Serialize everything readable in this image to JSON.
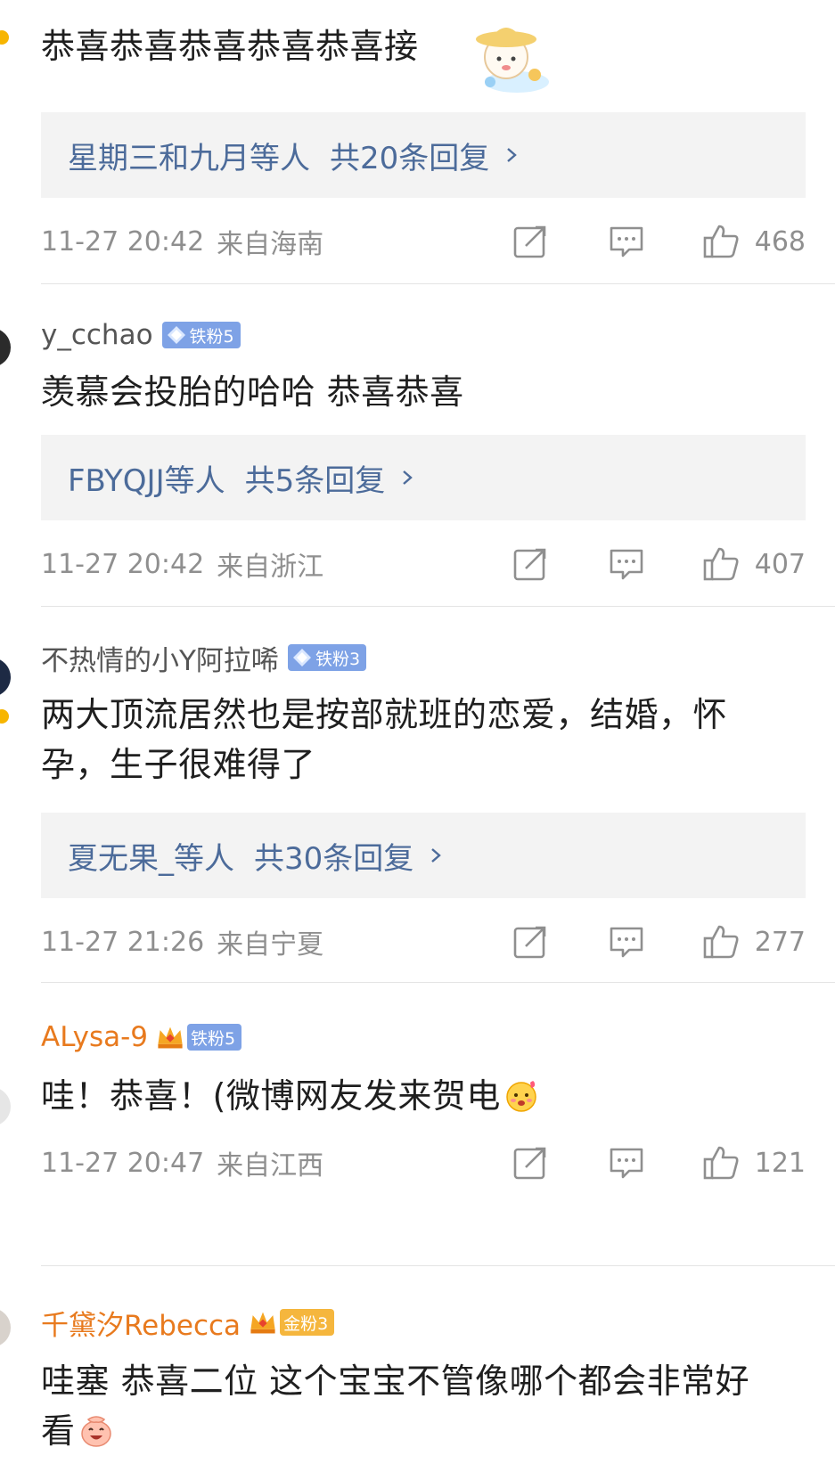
{
  "comments": [
    {
      "username": "",
      "text": "恭喜恭喜恭喜恭喜恭喜接",
      "replies": {
        "who": "星期三和九月等人",
        "count": "共20条回复"
      },
      "time": "11-27 20:42",
      "location": "来自海南",
      "likes": "468"
    },
    {
      "username": "y_cchao",
      "badge": "铁粉5",
      "text": "羡慕会投胎的哈哈 恭喜恭喜",
      "replies": {
        "who": "FBYQJJ等人",
        "count": "共5条回复"
      },
      "time": "11-27 20:42",
      "location": "来自浙江",
      "likes": "407"
    },
    {
      "username": "不热情的小Y阿拉唏",
      "badge": "铁粉3",
      "text": "两大顶流居然也是按部就班的恋爱，结婚，怀孕，生子很难得了",
      "replies": {
        "who": "夏无果_等人",
        "count": "共30条回复"
      },
      "time": "11-27 21:26",
      "location": "来自宁夏",
      "likes": "277"
    },
    {
      "username": "ALysa-9",
      "badge": "铁粉5",
      "text": "哇！恭喜！(微博网友发来贺电",
      "time": "11-27 20:47",
      "location": "来自江西",
      "likes": "121"
    },
    {
      "username": "千黛汐Rebecca",
      "badge": "金粉3",
      "text": "哇塞 恭喜二位 这个宝宝不管像哪个都会非常好看"
    }
  ],
  "icons": {
    "share": "share-icon",
    "comment": "comment-icon",
    "like": "thumbs-up-icon"
  },
  "colors": {
    "reply_link": "#4c6b9a",
    "vip_name": "#e87a1e",
    "iron_fan": "#7ea2e6",
    "gold_fan": "#f5b63d"
  }
}
